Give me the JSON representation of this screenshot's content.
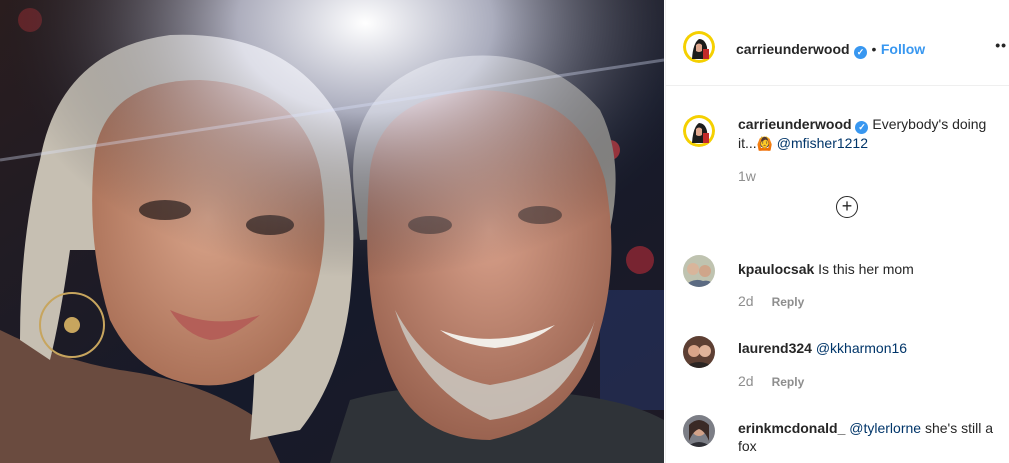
{
  "post": {
    "author": "carrieunderwood",
    "follow_label": "Follow",
    "more_glyph": "••",
    "bullet": "•",
    "verified_glyph": "✓"
  },
  "caption": {
    "username": "carrieunderwood",
    "text": " Everybody's doing it...",
    "emoji": "🙆",
    "mention": "@mfisher1212",
    "time": "1w",
    "load_more_glyph": "+"
  },
  "comments": [
    {
      "username": "kpaulocsak",
      "text": "Is this her mom",
      "mention": "",
      "time": "2d",
      "reply": "Reply"
    },
    {
      "username": "laurend324",
      "text": "",
      "mention": "@kkharmon16",
      "time": "2d",
      "reply": "Reply"
    },
    {
      "username": "erinkmcdonald_",
      "text": " she's still a fox",
      "mention": "@tylerlorne",
      "time": "",
      "reply": ""
    }
  ],
  "colors": {
    "link": "#3897f0",
    "mention": "#003569",
    "muted": "#8e8e8e"
  }
}
